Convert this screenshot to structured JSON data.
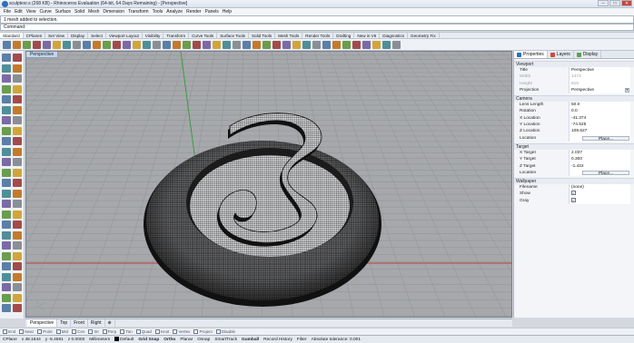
{
  "window": {
    "title": "sculptexr.s (268 KB) - Rhinoceros Evaluation (64-bit, 64 Days Remaining) - [Perspective]",
    "min": "–",
    "max": "□",
    "close": "✕"
  },
  "menu": [
    "File",
    "Edit",
    "View",
    "Curve",
    "Surface",
    "Solid",
    "Mesh",
    "Dimension",
    "Transform",
    "Tools",
    "Analyze",
    "Render",
    "Panels",
    "Help"
  ],
  "command": {
    "history": "1 mesh added to selection.",
    "label": "Command:"
  },
  "tabs": [
    "Standard",
    "CPlanes",
    "Set View",
    "Display",
    "Select",
    "Viewport Layout",
    "Visibility",
    "Transform",
    "Curve Tools",
    "Surface Tools",
    "Solid Tools",
    "Mesh Tools",
    "Render Tools",
    "Drafting",
    "New in V5",
    "Diagnostics",
    "Geometry Fix"
  ],
  "viewport": {
    "label": "Perspective"
  },
  "panel": {
    "tabs": [
      "Properties",
      "Layers",
      "Display"
    ],
    "sections": [
      {
        "title": "Viewport",
        "rows": [
          {
            "label": "Title",
            "value": "Perspective"
          },
          {
            "label": "Width",
            "value": "1473",
            "disabled": true
          },
          {
            "label": "Height",
            "value": "815",
            "disabled": true
          },
          {
            "label": "Projection",
            "value": "Perspective",
            "dropdown": true
          }
        ]
      },
      {
        "title": "Camera",
        "rows": [
          {
            "label": "Lens Length",
            "value": "50.0"
          },
          {
            "label": "Rotation",
            "value": "0.0"
          },
          {
            "label": "X Location",
            "value": "-41.374"
          },
          {
            "label": "Y Location",
            "value": "-74.525"
          },
          {
            "label": "Z Location",
            "value": "109.627"
          },
          {
            "label": "Location",
            "value": "Place...",
            "button": true
          }
        ]
      },
      {
        "title": "Target",
        "rows": [
          {
            "label": "X Target",
            "value": "2.037"
          },
          {
            "label": "Y Target",
            "value": "0.300"
          },
          {
            "label": "Z Target",
            "value": "-1.422"
          },
          {
            "label": "Location",
            "value": "Place...",
            "button": true
          }
        ]
      },
      {
        "title": "Wallpaper",
        "rows": [
          {
            "label": "Filename",
            "value": "(none)"
          },
          {
            "label": "Show",
            "value": "✓",
            "check": true
          },
          {
            "label": "Gray",
            "value": "✓",
            "check": true
          }
        ]
      }
    ]
  },
  "viewtabs": [
    "Perspective",
    "Top",
    "Front",
    "Right",
    "⊕"
  ],
  "osnaps": [
    "End",
    "Near",
    "Point",
    "Mid",
    "Cen",
    "Int",
    "Perp",
    "Tan",
    "Quad",
    "Knot",
    "Vertex",
    "Project",
    "Disable"
  ],
  "status": {
    "cplane": "CPlane",
    "x": "x 48.1544",
    "y": "y -5.4591",
    "z": "z 0.0000",
    "units": "Millimeters",
    "layer": "Default",
    "panes": [
      "Grid Snap",
      "Ortho",
      "Planar",
      "Osnap",
      "SmartTrack",
      "Gumball",
      "Record History",
      "Filter"
    ],
    "tolerance": "Absolute tolerance: 0.001"
  },
  "colors": {
    "accent": "#2a6fb8",
    "axis_x": "#c33c3c",
    "axis_y": "#2f9a3b",
    "grid": "#8f9396",
    "viewport_bg": "#a6a8ab"
  }
}
